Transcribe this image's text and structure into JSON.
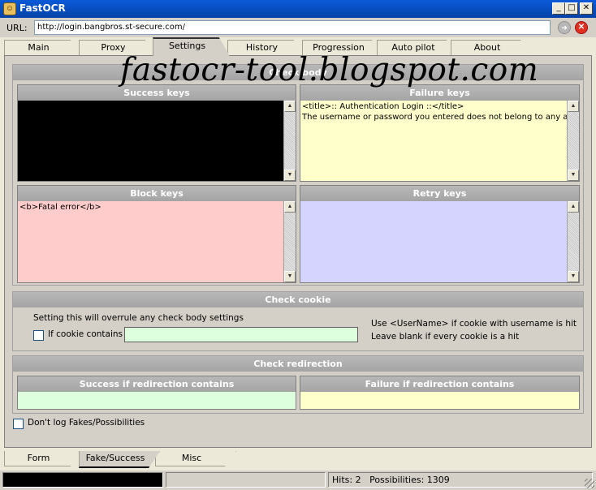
{
  "window": {
    "title": "FastOCR",
    "minimize": "_",
    "maximize": "□",
    "close": "✕"
  },
  "url_bar": {
    "label": "URL:",
    "value": "http://login.bangbros.st-secure.com/"
  },
  "top_tabs": [
    {
      "label": "Main"
    },
    {
      "label": "Proxy"
    },
    {
      "label": "Settings",
      "active": true
    },
    {
      "label": "History"
    },
    {
      "label": "Progression"
    },
    {
      "label": "Auto pilot"
    },
    {
      "label": "About"
    }
  ],
  "watermark": "fastocr-tool.blogspot.com",
  "check_body": {
    "title": "Check body",
    "success_keys": {
      "title": "Success keys",
      "text": ""
    },
    "failure_keys": {
      "title": "Failure keys",
      "text": "<title>:: Authentication Login ::</title>\nThe username or password you entered does not belong to any acco"
    },
    "block_keys": {
      "title": "Block keys",
      "text": "<b>Fatal error</b>"
    },
    "retry_keys": {
      "title": "Retry keys",
      "text": ""
    }
  },
  "check_cookie": {
    "title": "Check cookie",
    "note": "Setting this will overrule any check body settings",
    "checkbox_label": "If cookie contains",
    "input_value": "",
    "hint1": "Use <UserName> if cookie with username is hit",
    "hint2": "Leave blank if every cookie is a hit"
  },
  "check_redirection": {
    "title": "Check redirection",
    "success_title": "Success if redirection contains",
    "failure_title": "Failure if redirection contains"
  },
  "dont_log_label": "Don't log Fakes/Possibilities",
  "bottom_tabs": [
    {
      "label": "Form"
    },
    {
      "label": "Fake/Success",
      "active": true
    },
    {
      "label": "Misc"
    }
  ],
  "status": {
    "hits_text": "Hits: 2",
    "possibilities_text": "Possibilities: 1309"
  },
  "colors": {
    "success_bg": "#000000",
    "failure_bg": "#ffffcc",
    "block_bg": "#ffcccc",
    "retry_bg": "#d4d4ff",
    "cookie_bg": "#ddffdd",
    "redir_success_bg": "#ddffdd",
    "redir_failure_bg": "#ffffcc"
  }
}
